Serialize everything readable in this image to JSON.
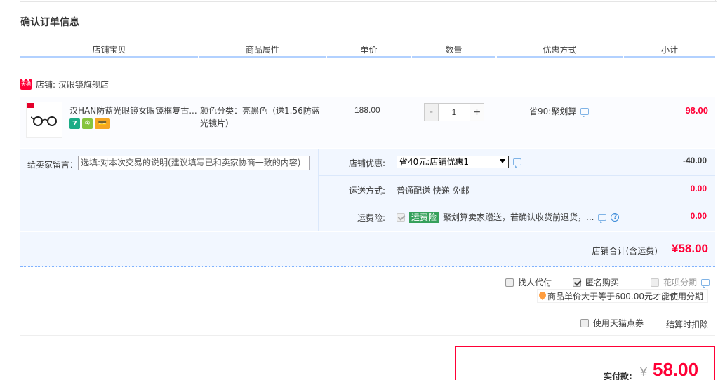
{
  "page_title": "确认订单信息",
  "columns": [
    "店铺宝贝",
    "商品属性",
    "单价",
    "数量",
    "优惠方式",
    "小计"
  ],
  "shop": {
    "badge": "天猫",
    "label": "店铺: 汉眼镜旗舰店"
  },
  "item": {
    "thumb_logo": "HAN",
    "title": "汉HAN防蓝光眼镜女眼镜框复古...",
    "icons": [
      "7",
      "♔",
      "💳"
    ],
    "attr": "颜色分类：亮黑色（送1.56防蓝光镜片）",
    "unit_price": "188.00",
    "quantity": "1",
    "qty_minus": "-",
    "qty_plus": "+",
    "discount": "省90:聚划算",
    "subtotal": "98.00"
  },
  "message": {
    "label": "给卖家留言：",
    "placeholder": "选填:对本次交易的说明(建议填写已和卖家协商一致的内容)"
  },
  "options": [
    {
      "label": "店铺优惠:",
      "select_value": "省40元:店铺优惠1",
      "amount": "-40.00"
    },
    {
      "label": "运送方式:",
      "value": "普通配送 快递 免邮",
      "amount": "0.00"
    },
    {
      "label": "运费险:",
      "tag": "运费险",
      "value": "聚划算卖家赠送，若确认收货前退货，...",
      "amount": "0.00"
    }
  ],
  "shop_total": {
    "label": "店铺合计(含运费)",
    "value": "¥58.00"
  },
  "extras": {
    "proxy_pay": "找人代付",
    "anonymous": "匿名购买",
    "huabei": "花呗分期",
    "huabei_hint": "商品单价大于等于600.00元才能使用分期",
    "coupon": "使用天猫点券",
    "coupon_note": "结算时扣除"
  },
  "payment": {
    "label": "实付款:",
    "currency": "¥",
    "value": "58.00"
  },
  "colors": {
    "accent_red": "#ff0036",
    "header_bar": "#b2d1ff",
    "panel_bg": "#f2f7ff"
  }
}
